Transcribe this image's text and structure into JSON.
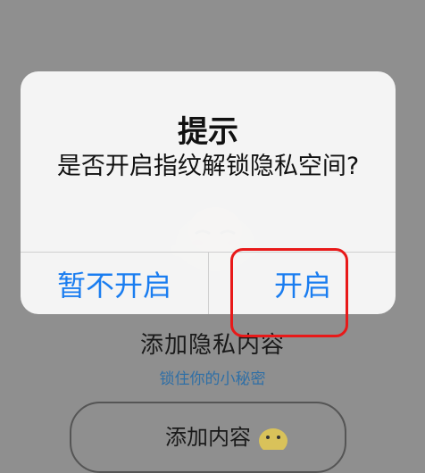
{
  "background": {
    "section_title": "添加隐私内容",
    "section_subtitle": "锁住你的小秘密",
    "add_button_label": "添加内容"
  },
  "dialog": {
    "title": "提示",
    "message": "是否开启指纹解锁隐私空间?",
    "cancel_label": "暂不开启",
    "confirm_label": "开启"
  },
  "colors": {
    "overlay": "#8f8f8f",
    "dialog_bg": "#f8f8f8",
    "button_text": "#1a7df0",
    "subtitle_text": "#2f6fa6",
    "highlight": "#e81919"
  },
  "icons": {
    "mascot": "cartoon-mascot-icon",
    "chick": "chick-icon"
  }
}
